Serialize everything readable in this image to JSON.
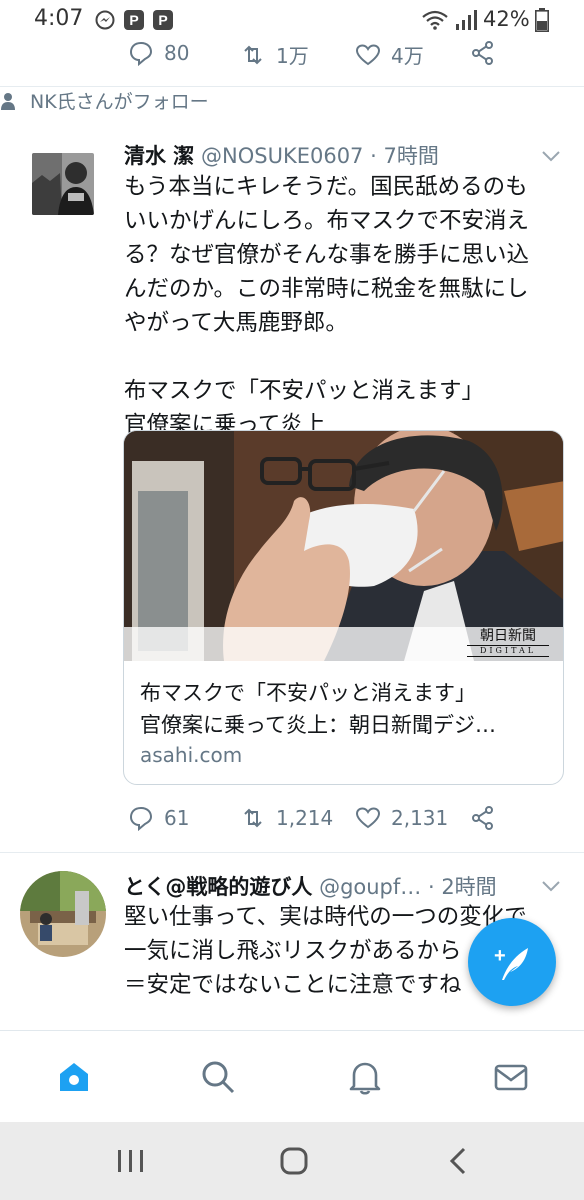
{
  "status_bar": {
    "time": "4:07",
    "battery": "42%"
  },
  "prev_tweet_actions": {
    "replies": "80",
    "retweets": "1万",
    "likes": "4万"
  },
  "tweet1": {
    "social_context": "NK氏さんがフォロー",
    "name": "清水 潔",
    "handle": "@NOSUKE0607",
    "time": "· 7時間",
    "body": "もう本当にキレそうだ。国民舐めるのも\nいいかげんにしろ。布マスクで不安消え\nる？なぜ官僚がそんな事を勝手に思い込\nんだのか。この非常時に税金を無駄にし\nやがって大馬鹿野郎。\n\n布マスクで「不安パッと消えます」\n官僚案に乗って炎上",
    "card": {
      "title": "布マスクで「不安パッと消えます」\n官僚案に乗って炎上：朝日新聞デジ…",
      "domain": "asahi.com",
      "watermark_top": "朝日新聞",
      "watermark_bottom": "DIGITAL"
    },
    "actions": {
      "replies": "61",
      "retweets": "1,214",
      "likes": "2,131"
    }
  },
  "tweet2": {
    "name": "とく@戦略的遊び人",
    "handle": "@goupf…",
    "time": "· 2時間",
    "body": "堅い仕事って、実は時代の一つの変化で\n一気に消し飛ぶリスクがあるから\n＝安定ではないことに注意ですね"
  },
  "fab": {
    "label": "+"
  },
  "colors": {
    "accent": "#1da1f2",
    "secondary_text": "#657786",
    "divider": "#e6ecf0"
  },
  "icons": {
    "reply": "reply-icon",
    "retweet": "retweet-icon",
    "like": "heart-icon",
    "share": "share-icon",
    "home": "home-icon",
    "search": "search-icon",
    "notifications": "bell-icon",
    "messages": "mail-icon"
  }
}
